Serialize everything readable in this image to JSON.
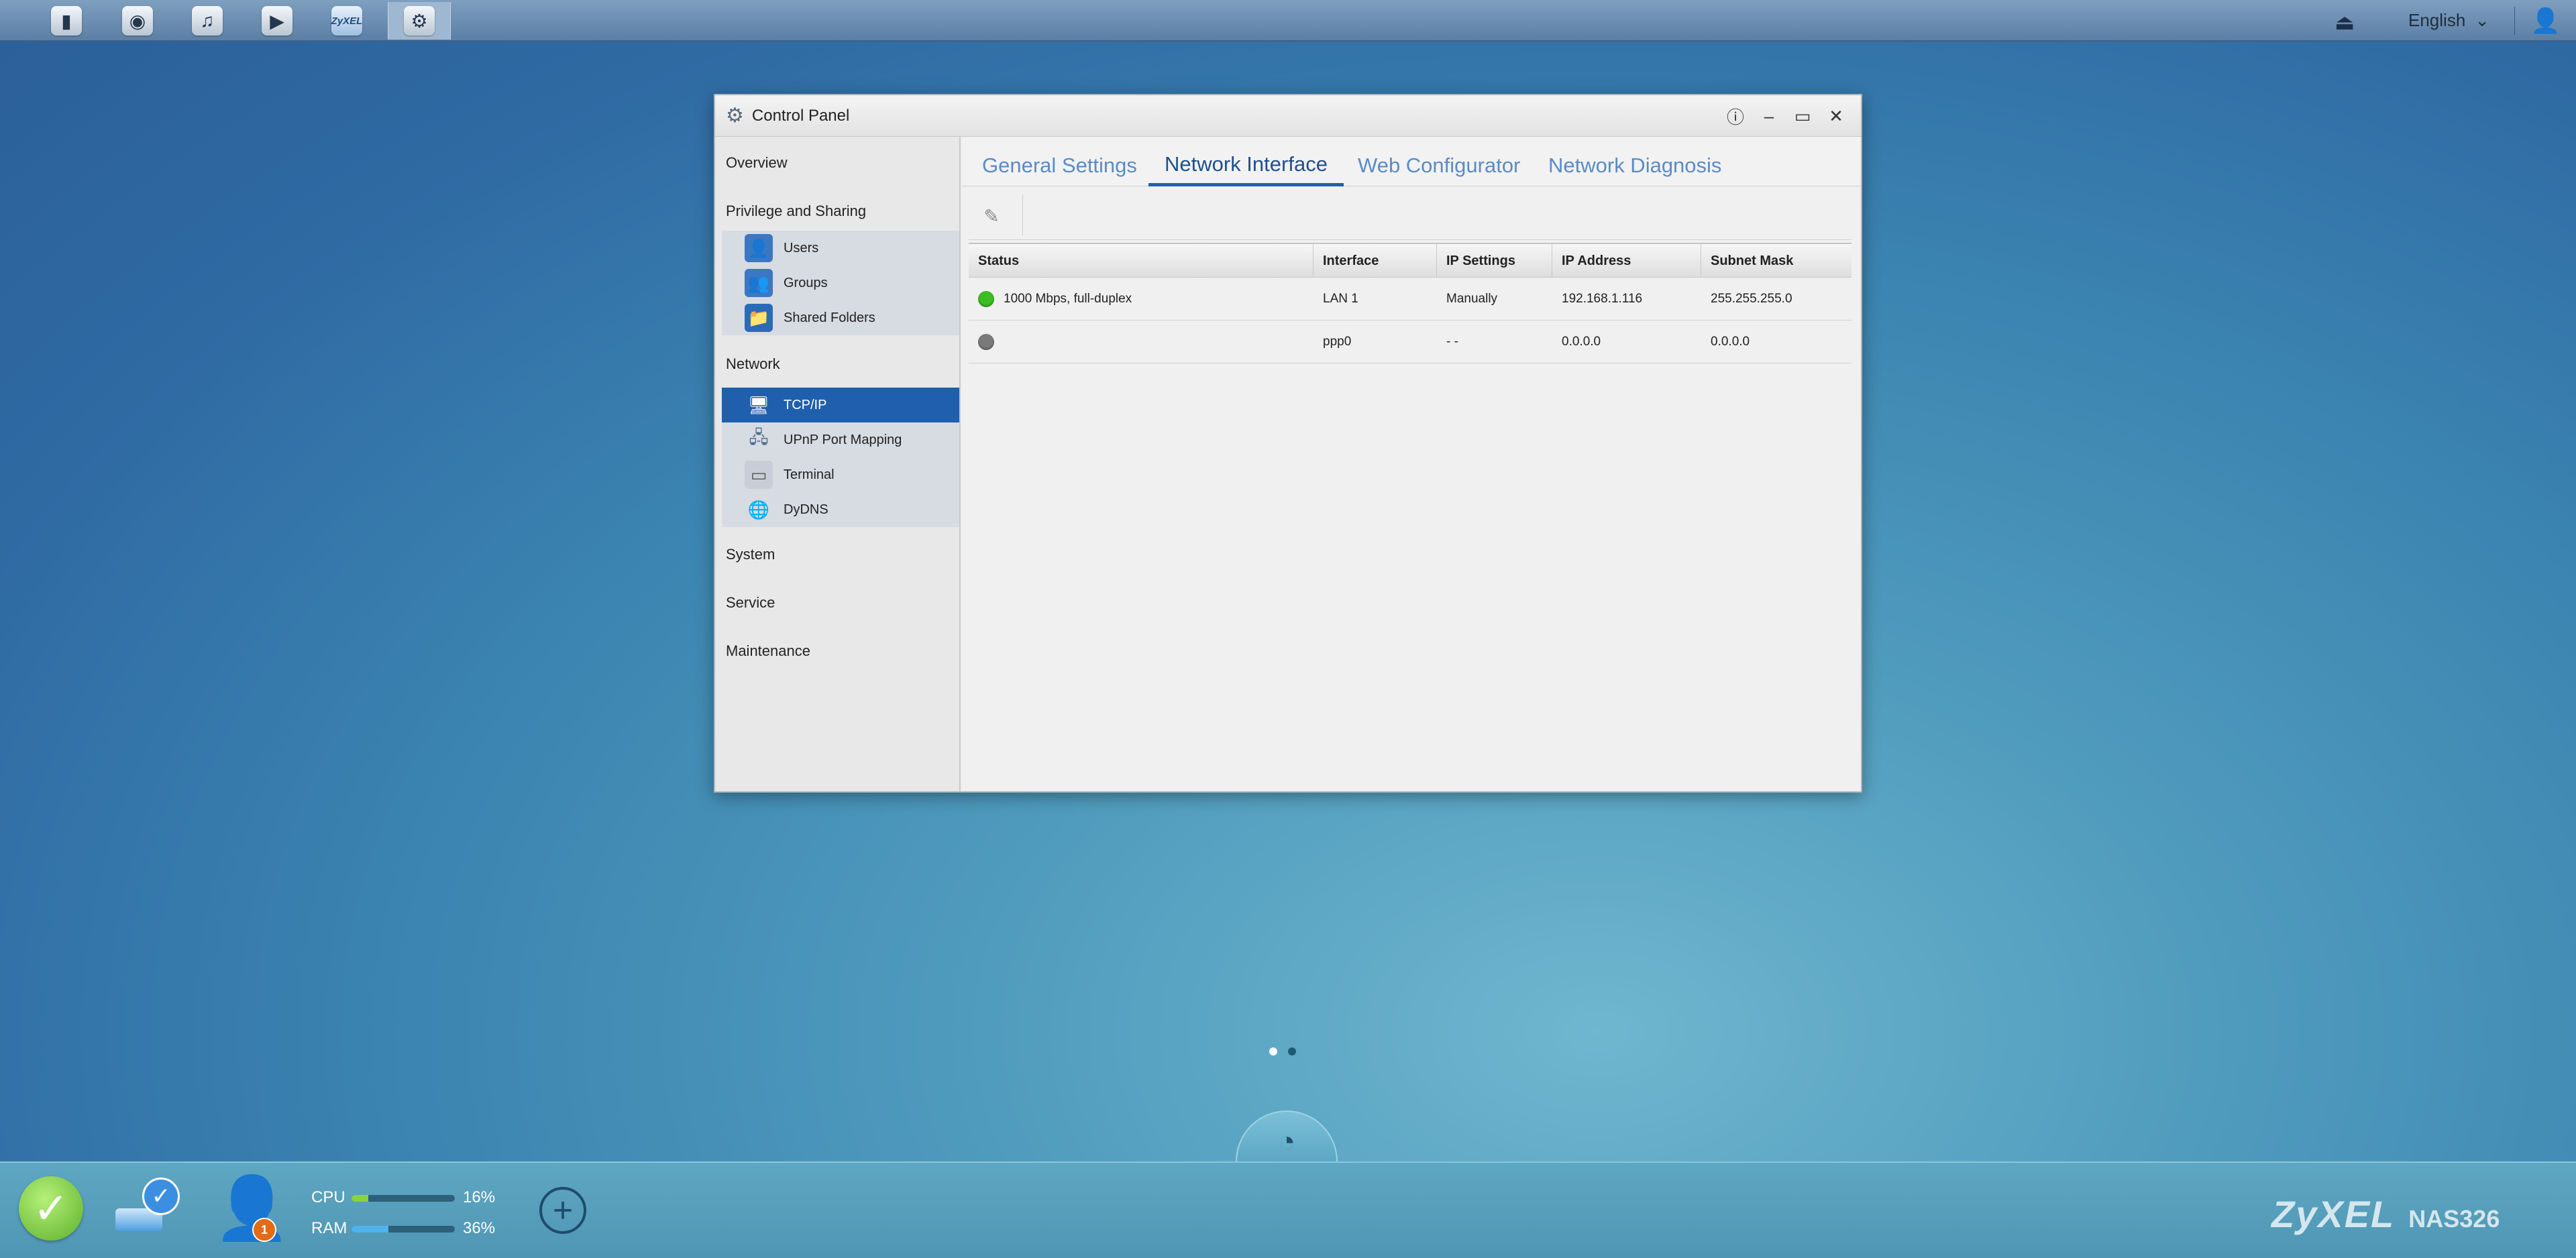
{
  "topbar": {
    "apps": [
      {
        "name": "file-browser",
        "glyph": "▮"
      },
      {
        "name": "photo",
        "glyph": "◉"
      },
      {
        "name": "music",
        "glyph": "♫"
      },
      {
        "name": "video",
        "glyph": "▶"
      },
      {
        "name": "zyxel-cloud",
        "glyph": "ZyXEL"
      },
      {
        "name": "control-panel",
        "glyph": "⚙"
      }
    ],
    "language": "English"
  },
  "window": {
    "title": "Control Panel",
    "sidebar": {
      "overview": "Overview",
      "privilege": "Privilege and Sharing",
      "privilege_items": [
        {
          "label": "Users",
          "icon": "👤"
        },
        {
          "label": "Groups",
          "icon": "👥"
        },
        {
          "label": "Shared Folders",
          "icon": "📁"
        }
      ],
      "network": "Network",
      "network_items": [
        {
          "label": "TCP/IP",
          "icon": "🖥"
        },
        {
          "label": "UPnP Port Mapping",
          "icon": "🖧"
        },
        {
          "label": "Terminal",
          "icon": "▭"
        },
        {
          "label": "DyDNS",
          "icon": "🌐"
        }
      ],
      "system": "System",
      "service": "Service",
      "maintenance": "Maintenance"
    },
    "tabs": [
      "General Settings",
      "Network Interface",
      "Web Configurator",
      "Network Diagnosis"
    ],
    "active_tab": "Network Interface",
    "table": {
      "headers": [
        "Status",
        "Interface",
        "IP Settings",
        "IP Address",
        "Subnet Mask"
      ],
      "rows": [
        {
          "status": "1000 Mbps, full-duplex",
          "status_color": "#3dbd21",
          "interface": "LAN 1",
          "ip_settings": "Manually",
          "ip_address": "192.168.1.116",
          "subnet_mask": "255.255.255.0"
        },
        {
          "status": "",
          "status_color": "#7a7a7a",
          "interface": "ppp0",
          "ip_settings": "- -",
          "ip_address": "0.0.0.0",
          "subnet_mask": "0.0.0.0"
        }
      ]
    }
  },
  "bottombar": {
    "cpu_label": "CPU",
    "cpu_value": "16%",
    "cpu_fraction": 0.16,
    "ram_label": "RAM",
    "ram_value": "36%",
    "ram_fraction": 0.36,
    "user_badge": "1",
    "brand": "ZyXEL",
    "model": "NAS326"
  },
  "colors": {
    "accent": "#1f5fad",
    "cpu_fill": "#8bd33c",
    "ram_fill": "#4fb3ee"
  }
}
